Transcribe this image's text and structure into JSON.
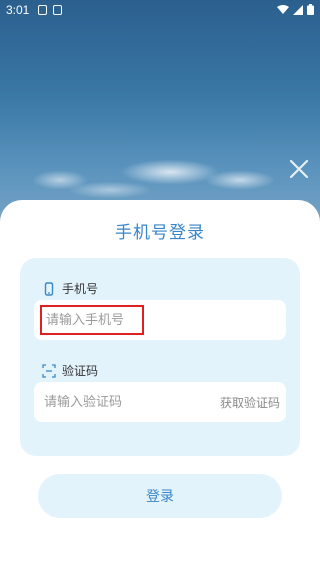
{
  "status_bar": {
    "time": "3:01"
  },
  "login": {
    "title": "手机号登录",
    "phone": {
      "label": "手机号",
      "placeholder": "请输入手机号",
      "value": ""
    },
    "code": {
      "label": "验证码",
      "placeholder": "请输入验证码",
      "value": "",
      "get_code_label": "获取验证码"
    },
    "submit_label": "登录"
  },
  "colors": {
    "accent": "#3a86c8",
    "card_bg": "#e3f3fc",
    "highlight": "#e02020"
  }
}
